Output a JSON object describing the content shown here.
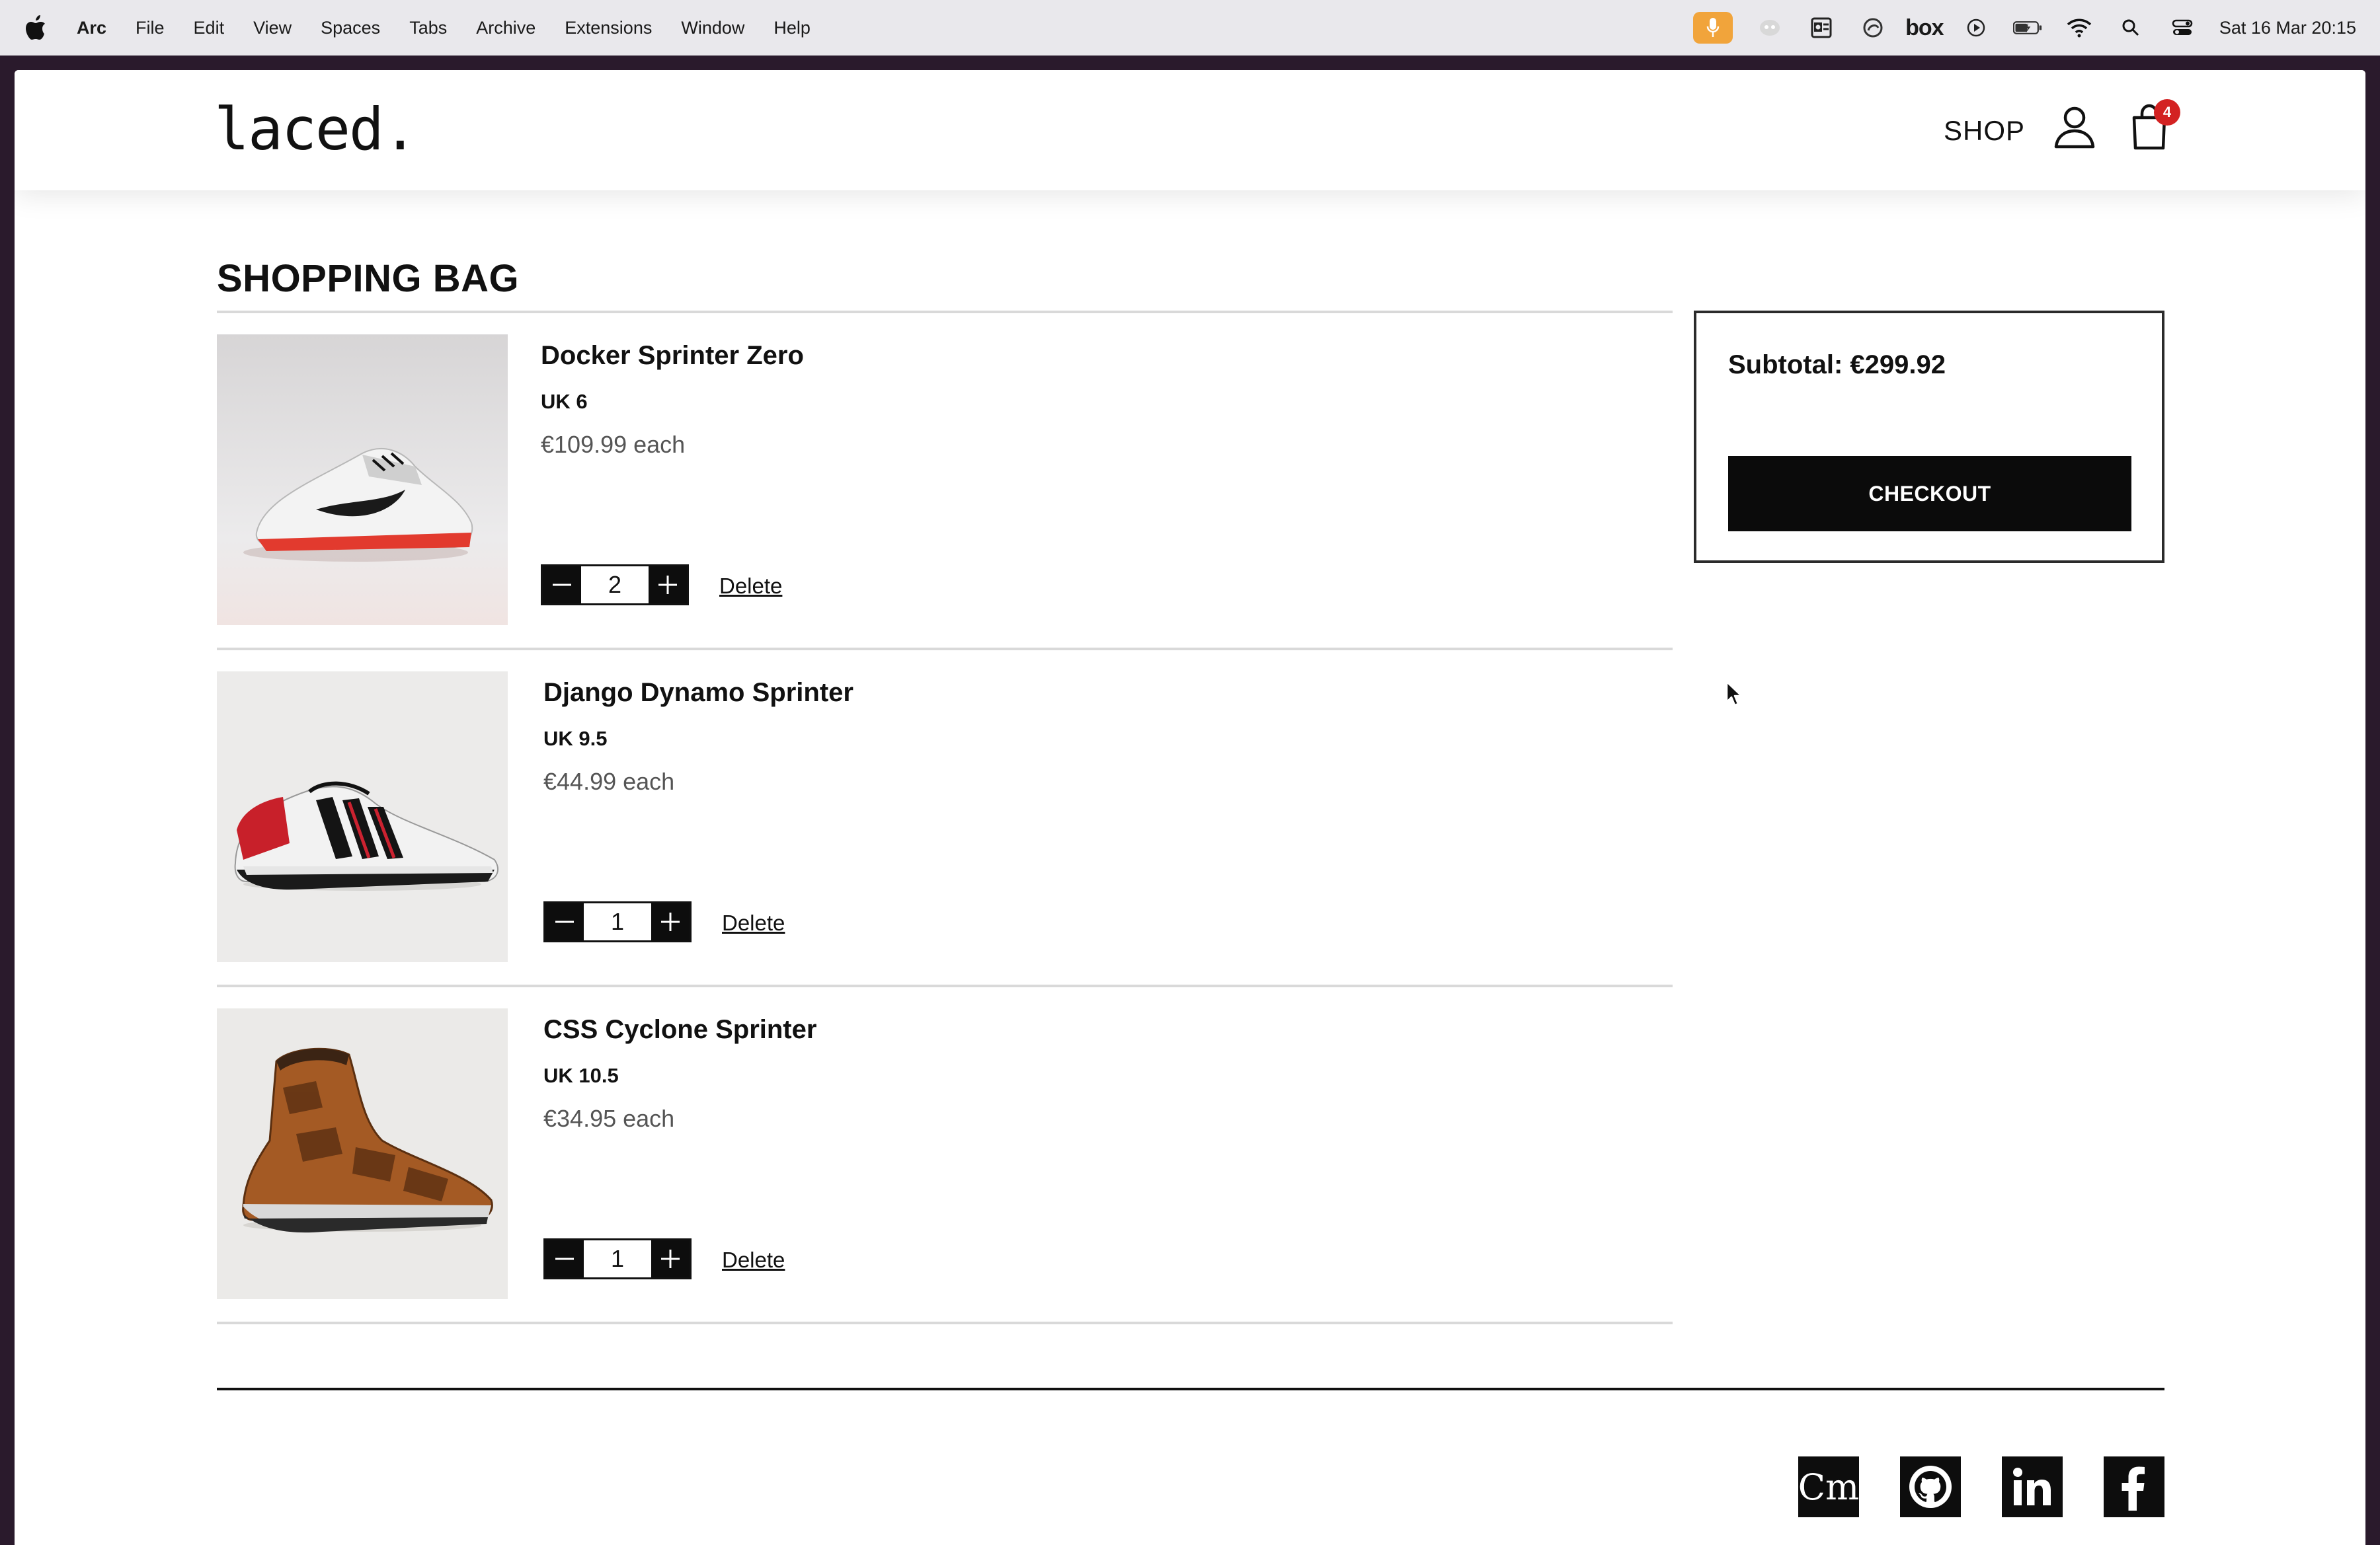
{
  "menubar": {
    "app_name": "Arc",
    "items": [
      "File",
      "Edit",
      "View",
      "Spaces",
      "Tabs",
      "Archive",
      "Extensions",
      "Window",
      "Help"
    ],
    "status_icons": [
      "microphone-icon",
      "shield-icon",
      "outlook-icon",
      "arc-icon",
      "box-icon",
      "play-icon",
      "battery-icon",
      "wifi-icon",
      "search-icon",
      "control-center-icon"
    ],
    "box_label": "box",
    "clock": "Sat 16 Mar  20:15",
    "mic_color": "#f1a43b"
  },
  "site": {
    "logo": "laced.",
    "nav_shop": "SHOP",
    "cart_count": "4",
    "badge_color": "#d32222"
  },
  "page": {
    "title": "SHOPPING BAG"
  },
  "items": [
    {
      "name": "Docker Sprinter Zero",
      "size": "UK 6",
      "price": "€109.99 each",
      "quantity": "2",
      "delete_label": "Delete",
      "image": "white-running-shoe"
    },
    {
      "name": "Django Dynamo Sprinter",
      "size": "UK 9.5",
      "price": "€44.99 each",
      "quantity": "1",
      "delete_label": "Delete",
      "image": "white-red-black-striped-shoe"
    },
    {
      "name": "CSS Cyclone Sprinter",
      "size": "UK 10.5",
      "price": "€34.95 each",
      "quantity": "1",
      "delete_label": "Delete",
      "image": "brown-hiking-boot"
    }
  ],
  "summary": {
    "subtotal": "Subtotal: €299.92",
    "checkout_label": "CHECKOUT"
  },
  "footer": {
    "social": [
      {
        "name": "codementor-icon",
        "label": "Cm"
      },
      {
        "name": "github-icon"
      },
      {
        "name": "linkedin-icon"
      },
      {
        "name": "facebook-icon"
      }
    ]
  }
}
